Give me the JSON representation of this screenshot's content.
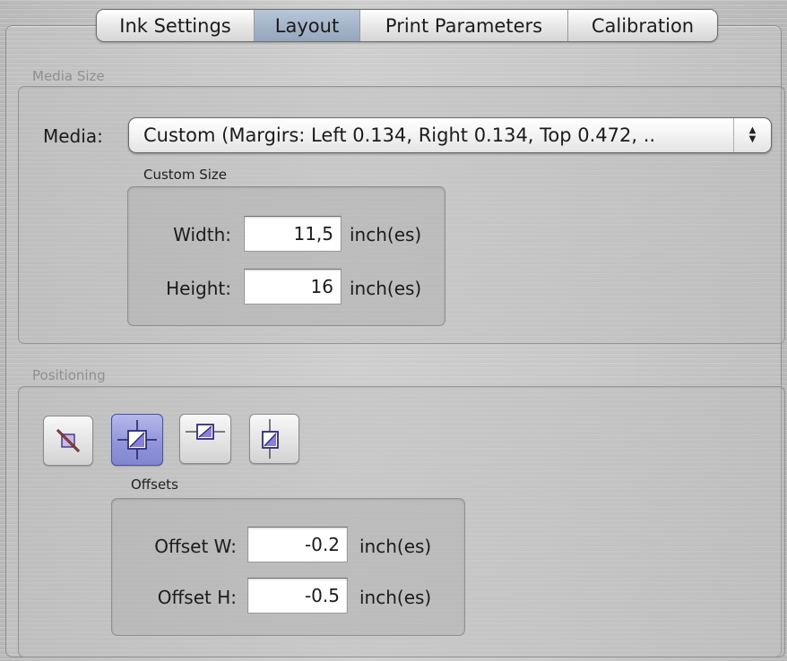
{
  "tabs": [
    {
      "label": "Ink Settings"
    },
    {
      "label": "Layout"
    },
    {
      "label": "Print Parameters"
    },
    {
      "label": "Calibration"
    }
  ],
  "selected_tab": "Layout",
  "media_size": {
    "group_title": "Media Size",
    "media_label": "Media:",
    "media_value": "Custom (Margirs: Left 0.134, Right 0.134, Top 0.472, ..",
    "custom_size_title": "Custom Size",
    "width_label": "Width:",
    "width_value": "11,5",
    "width_unit": "inch(es)",
    "height_label": "Height:",
    "height_value": "16",
    "height_unit": "inch(es)"
  },
  "positioning": {
    "group_title": "Positioning",
    "buttons": [
      {
        "icon": "no-positioning-icon"
      },
      {
        "icon": "center-both-icon"
      },
      {
        "icon": "center-horizontal-icon"
      },
      {
        "icon": "center-vertical-icon"
      }
    ],
    "selected_button": 1,
    "offsets_title": "Offsets",
    "offset_w_label": "Offset W:",
    "offset_w_value": "-0.2",
    "offset_w_unit": "inch(es)",
    "offset_h_label": "Offset H:",
    "offset_h_value": "-0.5",
    "offset_h_unit": "inch(es)"
  },
  "colors": {
    "selected_tab": "#a3b3c9",
    "selected_position_button": "#8f93d8"
  }
}
